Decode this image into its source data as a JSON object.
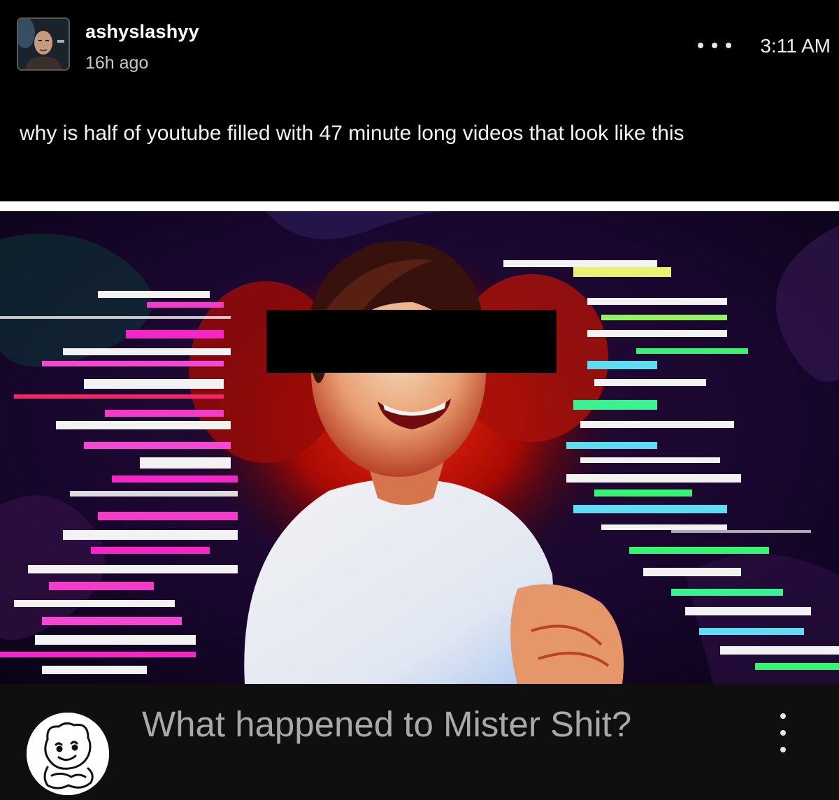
{
  "post": {
    "username": "ashyslashyy",
    "time_ago": "16h ago",
    "clock": "3:11 AM",
    "text": "why is half of youtube filled with 47 minute long videos that look like this",
    "avatar_icon": "profile-photo-icon",
    "more_icon": "more-horizontal-icon"
  },
  "video": {
    "title": "What happened to Mister Shit?",
    "channel_icon": "cartoon-character-icon",
    "menu_icon": "more-vertical-icon"
  },
  "colors": {
    "background": "#000000",
    "video_row_bg": "#0f0f0f",
    "video_title": "#a9a9a9",
    "timeago": "#c9c9c9"
  }
}
